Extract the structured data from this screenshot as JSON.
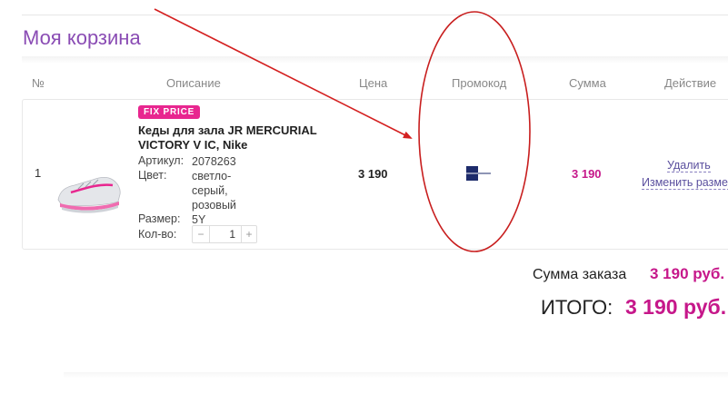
{
  "page": {
    "title": "Моя корзина"
  },
  "table": {
    "headers": {
      "num": "№",
      "description": "Описание",
      "price": "Цена",
      "promo": "Промокод",
      "sum": "Сумма",
      "action": "Действие"
    }
  },
  "item": {
    "num": "1",
    "badge": "FIX PRICE",
    "name": "Кеды для зала JR MERCURIAL VICTORY V IC, Nike",
    "article_label": "Артикул:",
    "article_value": "2078263",
    "color_label": "Цвет:",
    "color_value": "светло-серый, розовый",
    "size_label": "Размер:",
    "size_value": "5Y",
    "qty_label": "Кол-во:",
    "qty_minus": "−",
    "qty_value": "1",
    "qty_plus": "+",
    "price": "3 190",
    "sum": "3 190",
    "promo_icon": "flag-icon",
    "delete_label": "Удалить",
    "edit_label": "Изменить размер"
  },
  "totals": {
    "order_sum_label": "Сумма заказа",
    "order_sum_value": "3 190 руб.",
    "grand_total_label": "ИТОГО:",
    "grand_total_value": "3 190 руб."
  },
  "colors": {
    "title": "#8a4cb4",
    "accent": "#c6178a",
    "badge": "#e8268f",
    "link": "#5a4f9e",
    "annotation": "#d42020",
    "promo_icon": "#1d2b6b"
  }
}
